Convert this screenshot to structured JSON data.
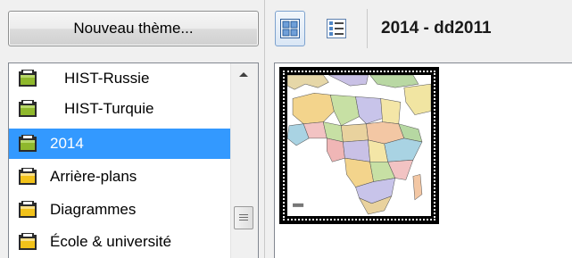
{
  "toolbar": {
    "new_theme_label": "Nouveau thème...",
    "view_grid_icon": "grid-view-icon",
    "view_list_icon": "list-view-icon"
  },
  "themes": {
    "items": [
      {
        "label": "HIST-Russie",
        "icon": "folder-icon-green"
      },
      {
        "label": "HIST-Turquie",
        "icon": "folder-icon-green"
      },
      {
        "label": "2014",
        "icon": "folder-icon-green",
        "selected": true
      },
      {
        "label": "Arrière-plans",
        "icon": "folder-icon-yellow"
      },
      {
        "label": "Diagrammes",
        "icon": "folder-icon-yellow"
      },
      {
        "label": "École & université",
        "icon": "folder-icon-yellow"
      }
    ]
  },
  "album": {
    "title": "2014 - dd2011"
  },
  "gallery": {
    "items": [
      {
        "icon": "africa-map-thumbnail",
        "selected": true
      }
    ]
  },
  "colors": {
    "selection": "#3399ff",
    "folder_green": "#8fb82c",
    "folder_yellow": "#f2c21a"
  }
}
